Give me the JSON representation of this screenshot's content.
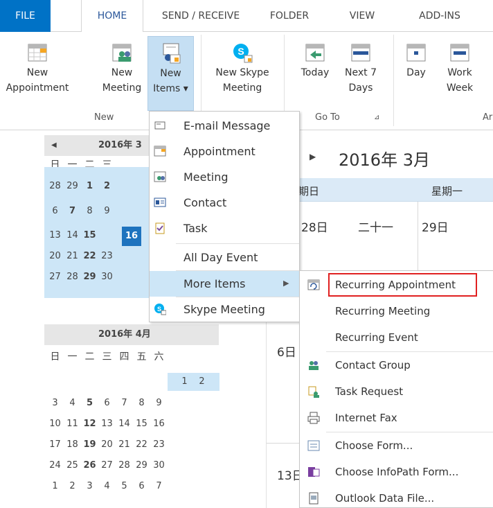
{
  "tabs": {
    "file": "FILE",
    "home": "HOME",
    "send_receive": "SEND / RECEIVE",
    "folder": "FOLDER",
    "view": "VIEW",
    "addins": "ADD-INS"
  },
  "ribbon": {
    "new_appointment_l1": "New",
    "new_appointment_l2": "Appointment",
    "new_meeting_l1": "New",
    "new_meeting_l2": "Meeting",
    "new_items_l1": "New",
    "new_items_l2": "Items ▾",
    "new_skype_l1": "New Skype",
    "new_skype_l2": "Meeting",
    "today": "Today",
    "next7_l1": "Next 7",
    "next7_l2": "Days",
    "day": "Day",
    "work_week_l1": "Work",
    "work_week_l2": "Week",
    "group_new": "New",
    "group_goto": "Go To",
    "group_arrange_partial": "Ar"
  },
  "navigator": {
    "march_header": "2016年 3",
    "april_header": "2016年 4月",
    "day_names": [
      "日",
      "一",
      "二",
      "三",
      "四",
      "五",
      "六"
    ],
    "march_rows": [
      [
        "28",
        "29",
        "1",
        "2"
      ],
      [
        "6",
        "7",
        "8",
        "9"
      ],
      [
        "13",
        "14",
        "15",
        "16"
      ],
      [
        "20",
        "21",
        "22",
        "23"
      ],
      [
        "27",
        "28",
        "29",
        "30"
      ]
    ],
    "april_rows": [
      [
        "",
        "",
        "",
        "",
        "",
        "1",
        "2"
      ],
      [
        "3",
        "4",
        "5",
        "6",
        "7",
        "8",
        "9"
      ],
      [
        "10",
        "11",
        "12",
        "13",
        "14",
        "15",
        "16"
      ],
      [
        "17",
        "18",
        "19",
        "20",
        "21",
        "22",
        "23"
      ],
      [
        "24",
        "25",
        "26",
        "27",
        "28",
        "29",
        "30"
      ],
      [
        "1",
        "2",
        "3",
        "4",
        "5",
        "6",
        "7"
      ]
    ]
  },
  "calendar": {
    "title": "2016年 3月",
    "col_sunday_partial": "期日",
    "col_monday": "星期一",
    "cell_28": "28日",
    "cell_lunar": "二十一",
    "cell_29": "29日",
    "cell_6": "6日",
    "cell_13": "13日"
  },
  "menu": {
    "email": "E-mail Message",
    "appointment": "Appointment",
    "meeting": "Meeting",
    "contact": "Contact",
    "task": "Task",
    "all_day": "All Day Event",
    "more_items": "More Items",
    "skype": "Skype Meeting"
  },
  "submenu": {
    "recurring_appointment": "Recurring Appointment",
    "recurring_meeting": "Recurring Meeting",
    "recurring_event": "Recurring Event",
    "contact_group": "Contact Group",
    "task_request": "Task Request",
    "internet_fax": "Internet Fax",
    "choose_form": "Choose Form...",
    "choose_infopath": "Choose InfoPath Form...",
    "outlook_data_file": "Outlook Data File..."
  },
  "colors": {
    "file_tab": "#0072c6",
    "accent": "#2b579a",
    "selection": "#cde6f7",
    "today": "#1e73be",
    "highlight_box": "#e02020"
  }
}
